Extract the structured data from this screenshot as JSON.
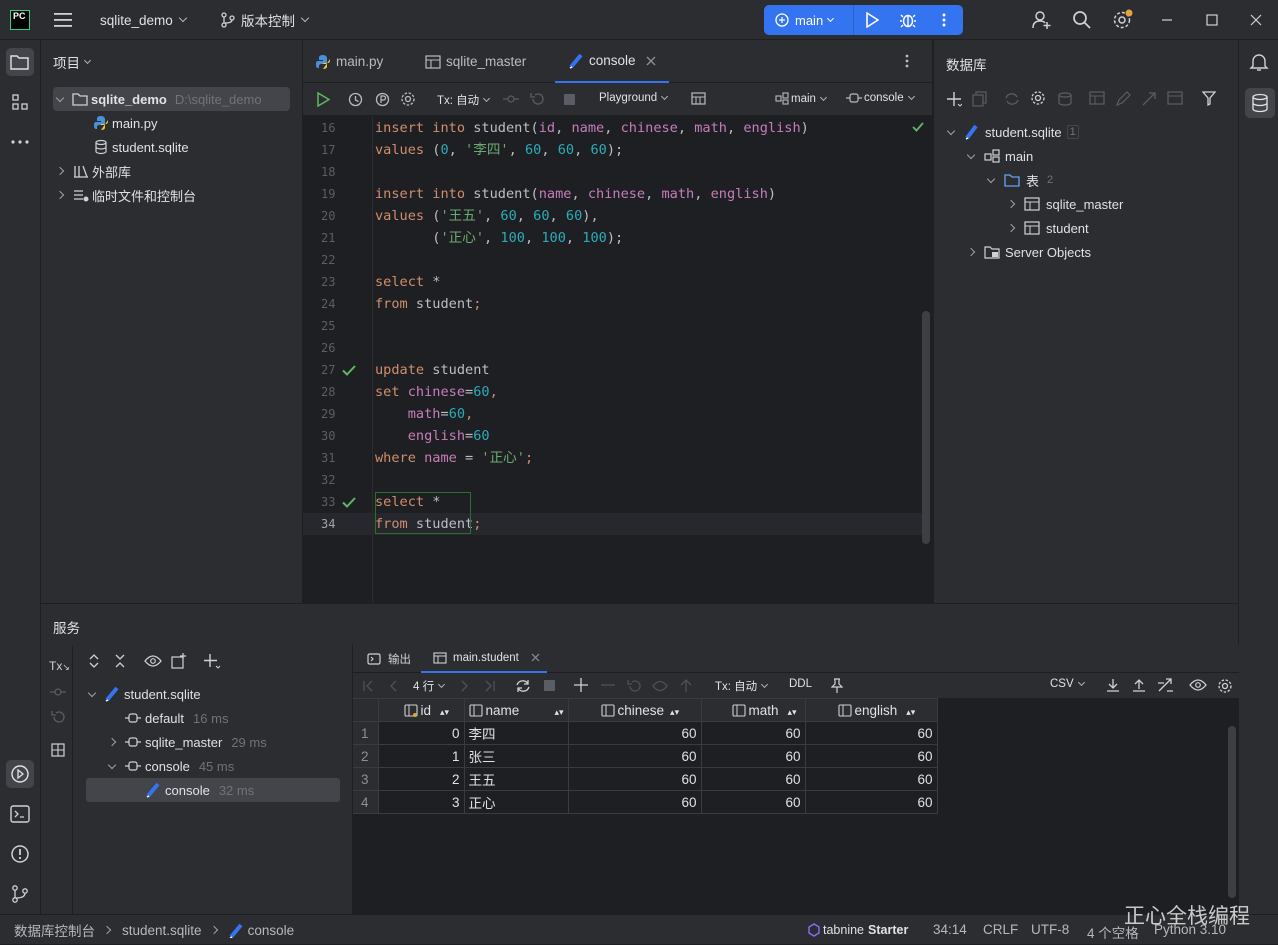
{
  "titlebar": {
    "logo": "PC",
    "project": "sqlite_demo",
    "vcs": "版本控制",
    "run_config": "main"
  },
  "project_panel": {
    "title": "项目",
    "root_name": "sqlite_demo",
    "root_path": "D:\\sqlite_demo",
    "files": [
      "main.py",
      "student.sqlite"
    ],
    "ext_libs": "外部库",
    "scratches": "临时文件和控制台"
  },
  "editor": {
    "tabs": [
      "main.py",
      "sqlite_master",
      "console"
    ],
    "active_tab": "console",
    "toolbar": {
      "tx": "Tx: 自动",
      "playground": "Playground",
      "schema": "main",
      "session": "console"
    },
    "active_line": "34",
    "lines": [
      {
        "n": "16",
        "mark": ""
      },
      {
        "n": "17",
        "mark": ""
      },
      {
        "n": "18",
        "mark": ""
      },
      {
        "n": "19",
        "mark": ""
      },
      {
        "n": "20",
        "mark": ""
      },
      {
        "n": "21",
        "mark": ""
      },
      {
        "n": "22",
        "mark": ""
      },
      {
        "n": "23",
        "mark": ""
      },
      {
        "n": "24",
        "mark": ""
      },
      {
        "n": "25",
        "mark": ""
      },
      {
        "n": "26",
        "mark": ""
      },
      {
        "n": "27",
        "mark": "check"
      },
      {
        "n": "28",
        "mark": ""
      },
      {
        "n": "29",
        "mark": ""
      },
      {
        "n": "30",
        "mark": ""
      },
      {
        "n": "31",
        "mark": ""
      },
      {
        "n": "32",
        "mark": ""
      },
      {
        "n": "33",
        "mark": "check"
      },
      {
        "n": "34",
        "mark": ""
      }
    ],
    "code": [
      [
        [
          "kw",
          "insert into "
        ],
        [
          "id",
          "student("
        ],
        [
          "col",
          "id"
        ],
        [
          "id",
          ", "
        ],
        [
          "col",
          "name"
        ],
        [
          "id",
          ", "
        ],
        [
          "col",
          "chinese"
        ],
        [
          "id",
          ", "
        ],
        [
          "col",
          "math"
        ],
        [
          "id",
          ", "
        ],
        [
          "col",
          "english"
        ],
        [
          "id",
          ")"
        ]
      ],
      [
        [
          "kw",
          "values "
        ],
        [
          "id",
          "("
        ],
        [
          "num",
          "0"
        ],
        [
          "id",
          ", "
        ],
        [
          "str",
          "'李四'"
        ],
        [
          "id",
          ", "
        ],
        [
          "num",
          "60"
        ],
        [
          "id",
          ", "
        ],
        [
          "num",
          "60"
        ],
        [
          "id",
          ", "
        ],
        [
          "num",
          "60"
        ],
        [
          "id",
          ");"
        ]
      ],
      [],
      [
        [
          "kw",
          "insert into "
        ],
        [
          "id",
          "student("
        ],
        [
          "col",
          "name"
        ],
        [
          "id",
          ", "
        ],
        [
          "col",
          "chinese"
        ],
        [
          "id",
          ", "
        ],
        [
          "col",
          "math"
        ],
        [
          "id",
          ", "
        ],
        [
          "col",
          "english"
        ],
        [
          "id",
          ")"
        ]
      ],
      [
        [
          "kw",
          "values "
        ],
        [
          "id",
          "("
        ],
        [
          "str",
          "'王五'"
        ],
        [
          "id",
          ", "
        ],
        [
          "num",
          "60"
        ],
        [
          "id",
          ", "
        ],
        [
          "num",
          "60"
        ],
        [
          "id",
          ", "
        ],
        [
          "num",
          "60"
        ],
        [
          "id",
          "),"
        ]
      ],
      [
        [
          "id",
          "       ("
        ],
        [
          "str",
          "'正心'"
        ],
        [
          "id",
          ", "
        ],
        [
          "num",
          "100"
        ],
        [
          "id",
          ", "
        ],
        [
          "num",
          "100"
        ],
        [
          "id",
          ", "
        ],
        [
          "num",
          "100"
        ],
        [
          "id",
          ");"
        ]
      ],
      [],
      [
        [
          "kw",
          "select "
        ],
        [
          "id",
          "*"
        ]
      ],
      [
        [
          "kw",
          "from "
        ],
        [
          "id",
          "student"
        ],
        [
          "kw",
          ";"
        ]
      ],
      [],
      [],
      [
        [
          "kw",
          "update "
        ],
        [
          "id",
          "student"
        ]
      ],
      [
        [
          "kw",
          "set "
        ],
        [
          "col",
          "chinese"
        ],
        [
          "id",
          "="
        ],
        [
          "num",
          "60"
        ],
        [
          "kw",
          ","
        ]
      ],
      [
        [
          "id",
          "    "
        ],
        [
          "col",
          "math"
        ],
        [
          "id",
          "="
        ],
        [
          "num",
          "60"
        ],
        [
          "kw",
          ","
        ]
      ],
      [
        [
          "id",
          "    "
        ],
        [
          "col",
          "english"
        ],
        [
          "id",
          "="
        ],
        [
          "num",
          "60"
        ]
      ],
      [
        [
          "kw",
          "where "
        ],
        [
          "col",
          "name "
        ],
        [
          "id",
          "= "
        ],
        [
          "str",
          "'正心'"
        ],
        [
          "kw",
          ";"
        ]
      ],
      [],
      [
        [
          "kw",
          "select "
        ],
        [
          "id",
          "*"
        ]
      ],
      [
        [
          "kw",
          "from "
        ],
        [
          "id",
          "student"
        ],
        [
          "kw",
          ";"
        ]
      ]
    ]
  },
  "database_panel": {
    "title": "数据库",
    "datasource": "student.sqlite",
    "datasource_count": "1",
    "schema": "main",
    "tables_folder": "表",
    "tables_count": "2",
    "tables": [
      "sqlite_master",
      "student"
    ],
    "server_objects": "Server Objects"
  },
  "services": {
    "title": "服务",
    "tree": [
      {
        "label": "student.sqlite",
        "time": ""
      },
      {
        "label": "default",
        "time": "16 ms"
      },
      {
        "label": "sqlite_master",
        "time": "29 ms"
      },
      {
        "label": "console",
        "time": "45 ms"
      },
      {
        "label": "console",
        "time": "32 ms"
      }
    ],
    "tabs": [
      "输出",
      "main.student"
    ],
    "toolbar": {
      "rows": "4 行",
      "tx": "Tx: 自动",
      "ddl": "DDL",
      "export": "CSV"
    },
    "columns": [
      "id",
      "name",
      "chinese",
      "math",
      "english"
    ],
    "rows": [
      {
        "n": "1",
        "id": "0",
        "name": "李四",
        "chinese": "60",
        "math": "60",
        "english": "60"
      },
      {
        "n": "2",
        "id": "1",
        "name": "张三",
        "chinese": "60",
        "math": "60",
        "english": "60"
      },
      {
        "n": "3",
        "id": "2",
        "name": "王五",
        "chinese": "60",
        "math": "60",
        "english": "60"
      },
      {
        "n": "4",
        "id": "3",
        "name": "正心",
        "chinese": "60",
        "math": "60",
        "english": "60"
      }
    ]
  },
  "statusbar": {
    "crumbs": [
      "数据库控制台",
      "student.sqlite",
      "console"
    ],
    "tabnine": "tabnine",
    "tabnine_plan": "Starter",
    "position": "34:14",
    "line_sep": "CRLF",
    "encoding": "UTF-8",
    "indent": "4 个空格",
    "interpreter": "Python 3.10"
  },
  "watermark": "正心全栈编程",
  "colors": {
    "accent": "#3574f0",
    "keyword": "#cf8e6d",
    "string": "#6aab73",
    "number": "#2aacb8",
    "column": "#c77dbb",
    "check": "#5fb865"
  }
}
